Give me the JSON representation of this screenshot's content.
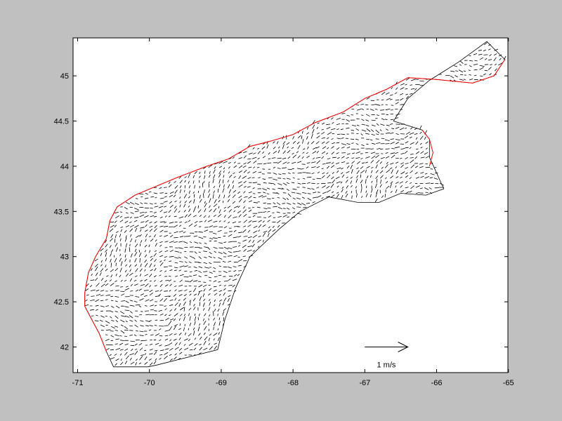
{
  "figure": {
    "background_color": "#c0c0c0",
    "axes_background": "#ffffff",
    "coast_color": "#ff0000",
    "arrow_color": "#000000"
  },
  "chart_data": {
    "type": "quiver",
    "title": "",
    "xlabel": "",
    "ylabel": "",
    "xlim": [
      -71,
      -65
    ],
    "ylim": [
      41.7,
      45.4
    ],
    "grid": false,
    "xticks": [
      -71,
      -70,
      -69,
      -68,
      -67,
      -66,
      -65
    ],
    "xtick_labels": [
      "-71",
      "-70",
      "-69",
      "-68",
      "-67",
      "-66",
      "-65"
    ],
    "yticks": [
      42,
      42.5,
      43,
      43.5,
      44,
      44.5,
      45
    ],
    "ytick_labels": [
      "42",
      "42.5",
      "43",
      "43.5",
      "44",
      "44.5",
      "45"
    ],
    "scale_arrow": {
      "label": "1 m/s",
      "magnitude": 1,
      "lon": -67,
      "lat": 42,
      "length_deg": 0.6
    },
    "domain_outline": [
      [
        -70.5,
        41.78
      ],
      [
        -70.02,
        41.78
      ],
      [
        -69.9,
        41.8
      ],
      [
        -69.05,
        41.97
      ],
      [
        -68.95,
        42.3
      ],
      [
        -68.8,
        42.65
      ],
      [
        -68.6,
        43.0
      ],
      [
        -68.2,
        43.3
      ],
      [
        -67.9,
        43.5
      ],
      [
        -67.5,
        43.66
      ],
      [
        -67.1,
        43.6
      ],
      [
        -66.8,
        43.6
      ],
      [
        -66.5,
        43.7
      ],
      [
        -66.15,
        43.68
      ],
      [
        -65.9,
        43.75
      ],
      [
        -66.1,
        44.1
      ],
      [
        -66.1,
        44.3
      ],
      [
        -66.2,
        44.4
      ],
      [
        -66.6,
        44.5
      ],
      [
        -66.4,
        44.75
      ],
      [
        -66.1,
        44.95
      ],
      [
        -65.7,
        45.15
      ],
      [
        -65.3,
        45.38
      ],
      [
        -65.05,
        45.18
      ],
      [
        -65.2,
        45.0
      ],
      [
        -65.5,
        44.92
      ],
      [
        -66.0,
        44.96
      ],
      [
        -66.4,
        44.98
      ],
      [
        -66.7,
        44.85
      ],
      [
        -67.0,
        44.75
      ],
      [
        -67.3,
        44.6
      ],
      [
        -67.7,
        44.48
      ],
      [
        -68.0,
        44.35
      ],
      [
        -68.3,
        44.28
      ],
      [
        -68.6,
        44.22
      ],
      [
        -68.9,
        44.08
      ],
      [
        -69.2,
        44.0
      ],
      [
        -69.6,
        43.88
      ],
      [
        -69.9,
        43.78
      ],
      [
        -70.2,
        43.68
      ],
      [
        -70.45,
        43.55
      ],
      [
        -70.55,
        43.4
      ],
      [
        -70.6,
        43.2
      ],
      [
        -70.75,
        43.0
      ],
      [
        -70.85,
        42.82
      ],
      [
        -70.9,
        42.6
      ],
      [
        -70.9,
        42.45
      ],
      [
        -70.8,
        42.3
      ],
      [
        -70.7,
        42.15
      ],
      [
        -70.6,
        41.95
      ]
    ],
    "coastline": [
      [
        -70.6,
        41.95
      ],
      [
        -70.7,
        42.15
      ],
      [
        -70.8,
        42.3
      ],
      [
        -70.9,
        42.45
      ],
      [
        -70.9,
        42.6
      ],
      [
        -70.85,
        42.82
      ],
      [
        -70.75,
        43.0
      ],
      [
        -70.6,
        43.2
      ],
      [
        -70.55,
        43.4
      ],
      [
        -70.45,
        43.55
      ],
      [
        -70.2,
        43.68
      ],
      [
        -69.9,
        43.78
      ],
      [
        -69.6,
        43.88
      ],
      [
        -69.2,
        44.0
      ],
      [
        -68.9,
        44.08
      ],
      [
        -68.6,
        44.22
      ],
      [
        -68.3,
        44.28
      ],
      [
        -68.0,
        44.35
      ],
      [
        -67.7,
        44.48
      ],
      [
        -67.3,
        44.6
      ],
      [
        -67.0,
        44.75
      ],
      [
        -66.7,
        44.85
      ],
      [
        -66.4,
        44.98
      ],
      [
        -66.0,
        44.96
      ],
      [
        -65.5,
        44.92
      ],
      [
        -65.2,
        45.0
      ],
      [
        -65.05,
        45.18
      ]
    ],
    "coastline_east": [
      [
        -66.2,
        44.4
      ],
      [
        -66.1,
        44.3
      ],
      [
        -66.05,
        44.15
      ],
      [
        -66.1,
        44.0
      ]
    ]
  }
}
